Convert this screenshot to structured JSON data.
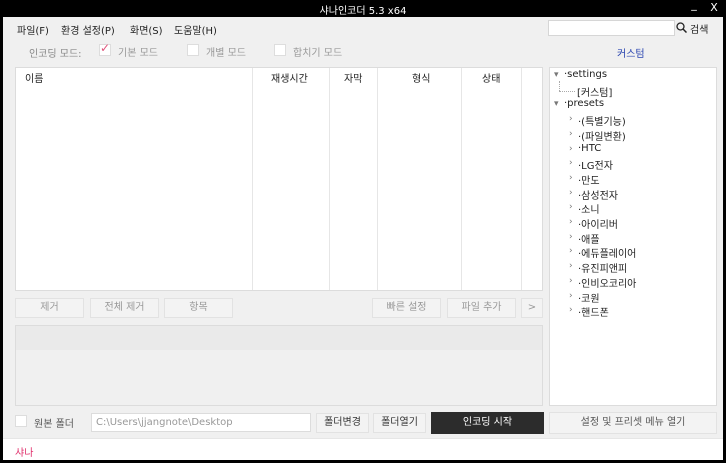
{
  "window": {
    "title": "샤나인코더  5.3 x64",
    "minimize": "_",
    "close": "X"
  },
  "menu": [
    "파일(F)",
    "환경 설정(P)",
    "화면(S)",
    "도움말(H)"
  ],
  "search": {
    "value": "",
    "button_label": "검색"
  },
  "mode": {
    "label": "인코딩 모드:",
    "options": [
      {
        "label": "기본 모드",
        "checked": true
      },
      {
        "label": "개별 모드",
        "checked": false
      },
      {
        "label": "합치기 모드",
        "checked": false
      }
    ]
  },
  "custom_link": "커스텀",
  "list": {
    "columns": [
      "이름",
      "재생시간",
      "자막",
      "형식",
      "상태"
    ],
    "rows": []
  },
  "list_buttons": {
    "remove": "제거",
    "remove_all": "전체 제거",
    "items": "항목",
    "quick_settings": "빠른 설정",
    "add_file": "파일 추가",
    "more": ">"
  },
  "tree": {
    "settings": {
      "label": "settings",
      "children": [
        "[커스텀]"
      ]
    },
    "presets": {
      "label": "presets",
      "children": [
        "(특별기능)",
        "(파일변환)",
        "HTC",
        "LG전자",
        "만도",
        "삼성전자",
        "소니",
        "아이리버",
        "애플",
        "에듀플레이어",
        "유진피앤피",
        "인비오코리아",
        "코원",
        "핸드폰"
      ]
    }
  },
  "bottom": {
    "orig_folder_label": "원본 폴더",
    "orig_folder_checked": false,
    "output_path": "C:\\Users\\jjangnote\\Desktop",
    "change_folder": "폴더변경",
    "open_folder": "폴더열기",
    "start_encoding": "인코딩 시작",
    "settings_menu": "설정 및 프리셋 메뉴 열기"
  },
  "status": "샤나",
  "colors": {
    "accent_pink": "#e0306c",
    "link_blue": "#2a45b0",
    "titlebar": "#000000",
    "start_button": "#2c2c2c"
  }
}
